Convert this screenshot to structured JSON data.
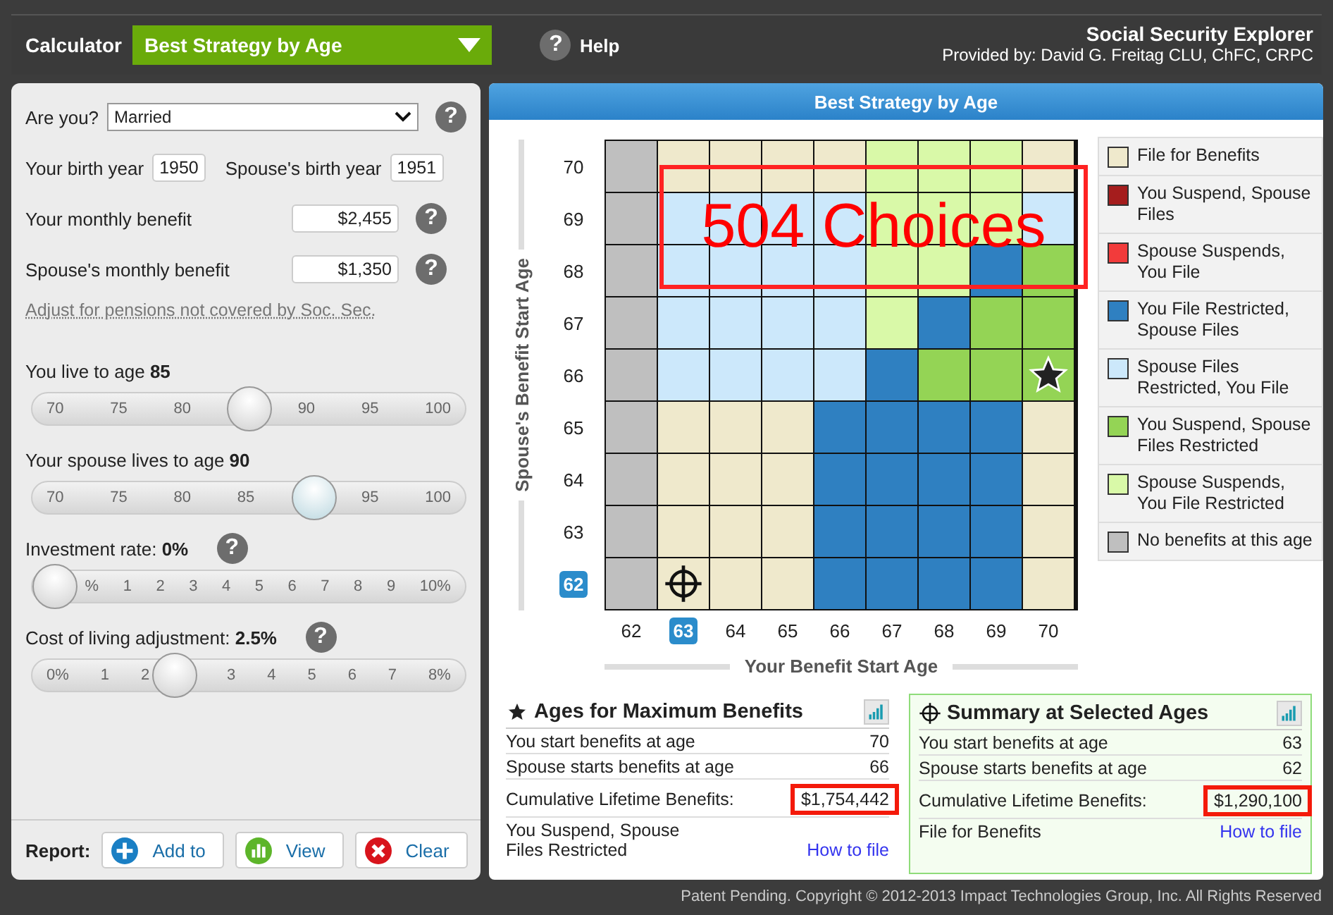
{
  "top_bar": {
    "label": "Calculator",
    "dropdown": "Best Strategy by Age",
    "help": {
      "glyph": "?",
      "label": "Help"
    },
    "title": "Social Security Explorer",
    "provider": "Provided by: David G. Freitag CLU, ChFC, CRPC"
  },
  "inputs": {
    "marital": {
      "label": "Are you?",
      "value": "Married",
      "help": "?"
    },
    "birth_years": [
      {
        "label": "Your birth year",
        "value": "1950"
      },
      {
        "label": "Spouse's birth year",
        "value": "1951"
      }
    ],
    "benefits": [
      {
        "label": "Your monthly benefit",
        "value": "$2,455",
        "help": "?"
      },
      {
        "label": "Spouse's monthly benefit",
        "value": "$1,350",
        "help": "?"
      }
    ],
    "adjust_link": "Adjust for pensions not covered by Soc. Sec."
  },
  "sliders": [
    {
      "label": "You live to age **85**",
      "level": 0.5,
      "ticks": [
        "70",
        "75",
        "80",
        "90",
        "95",
        "100"
      ]
    },
    {
      "label": "Your spouse lives to age **90**",
      "level": 0.67,
      "ticks": [
        "70",
        "75",
        "80",
        "85",
        "95",
        "100"
      ]
    },
    {
      "label": "Investment rate: **0%**",
      "help": "?",
      "level": 0,
      "ticks": [
        "%",
        "1",
        "2",
        "3",
        "4",
        "5",
        "6",
        "7",
        "8",
        "9",
        "10%"
      ]
    },
    {
      "label": "Cost of living adjustment: **2.5%**",
      "help": "?",
      "level": 0.31,
      "ticks": [
        "0%",
        "1",
        "2",
        "3",
        "4",
        "5",
        "6",
        "7",
        "8%"
      ]
    }
  ],
  "report": {
    "label": "Report:",
    "buttons": [
      {
        "kind": "add",
        "label": "Add to"
      },
      {
        "kind": "view",
        "label": "View"
      },
      {
        "kind": "clear",
        "label": "Clear"
      }
    ]
  },
  "chart": {
    "title": "Best Strategy by Age",
    "y_title": "Spouse's Benefit Start Age",
    "x_title": "Your Benefit Start Age",
    "annotation": "504 Choices",
    "rows": [
      {
        "label": "70",
        "selected": false,
        "cells": [
          {
            "kind": "none",
            "selected": false,
            "best": false
          },
          {
            "kind": "file",
            "selected": false,
            "best": false
          },
          {
            "kind": "file",
            "selected": false,
            "best": false
          },
          {
            "kind": "file",
            "selected": false,
            "best": false
          },
          {
            "kind": "file",
            "selected": false,
            "best": false
          },
          {
            "kind": "ss_restricted",
            "selected": false,
            "best": false
          },
          {
            "kind": "ss_restricted",
            "selected": false,
            "best": false
          },
          {
            "kind": "ss_restricted",
            "selected": false,
            "best": false
          },
          {
            "kind": "file",
            "selected": false,
            "best": false
          }
        ]
      },
      {
        "label": "69",
        "selected": false,
        "cells": [
          {
            "kind": "none",
            "selected": false,
            "best": false
          },
          {
            "kind": "spouse_restricted",
            "selected": false,
            "best": false
          },
          {
            "kind": "spouse_restricted",
            "selected": false,
            "best": false
          },
          {
            "kind": "spouse_restricted",
            "selected": false,
            "best": false
          },
          {
            "kind": "spouse_restricted",
            "selected": false,
            "best": false
          },
          {
            "kind": "ss_restricted",
            "selected": false,
            "best": false
          },
          {
            "kind": "ss_restricted",
            "selected": false,
            "best": false
          },
          {
            "kind": "ss_restricted",
            "selected": false,
            "best": false
          },
          {
            "kind": "spouse_restricted",
            "selected": false,
            "best": false
          }
        ]
      },
      {
        "label": "68",
        "selected": false,
        "cells": [
          {
            "kind": "none",
            "selected": false,
            "best": false
          },
          {
            "kind": "spouse_restricted",
            "selected": false,
            "best": false
          },
          {
            "kind": "spouse_restricted",
            "selected": false,
            "best": false
          },
          {
            "kind": "spouse_restricted",
            "selected": false,
            "best": false
          },
          {
            "kind": "spouse_restricted",
            "selected": false,
            "best": false
          },
          {
            "kind": "ss_restricted",
            "selected": false,
            "best": false
          },
          {
            "kind": "ss_restricted",
            "selected": false,
            "best": false
          },
          {
            "kind": "you_restricted",
            "selected": false,
            "best": false
          },
          {
            "kind": "ys_restricted",
            "selected": false,
            "best": false
          }
        ]
      },
      {
        "label": "67",
        "selected": false,
        "cells": [
          {
            "kind": "none",
            "selected": false,
            "best": false
          },
          {
            "kind": "spouse_restricted",
            "selected": false,
            "best": false
          },
          {
            "kind": "spouse_restricted",
            "selected": false,
            "best": false
          },
          {
            "kind": "spouse_restricted",
            "selected": false,
            "best": false
          },
          {
            "kind": "spouse_restricted",
            "selected": false,
            "best": false
          },
          {
            "kind": "ss_restricted",
            "selected": false,
            "best": false
          },
          {
            "kind": "you_restricted",
            "selected": false,
            "best": false
          },
          {
            "kind": "ys_restricted",
            "selected": false,
            "best": false
          },
          {
            "kind": "ys_restricted",
            "selected": false,
            "best": false
          }
        ]
      },
      {
        "label": "66",
        "selected": false,
        "cells": [
          {
            "kind": "none",
            "selected": false,
            "best": false
          },
          {
            "kind": "spouse_restricted",
            "selected": false,
            "best": false
          },
          {
            "kind": "spouse_restricted",
            "selected": false,
            "best": false
          },
          {
            "kind": "spouse_restricted",
            "selected": false,
            "best": false
          },
          {
            "kind": "spouse_restricted",
            "selected": false,
            "best": false
          },
          {
            "kind": "you_restricted",
            "selected": false,
            "best": false
          },
          {
            "kind": "ys_restricted",
            "selected": false,
            "best": false
          },
          {
            "kind": "ys_restricted",
            "selected": false,
            "best": false
          },
          {
            "kind": "ys_restricted",
            "selected": false,
            "best": true
          }
        ]
      },
      {
        "label": "65",
        "selected": false,
        "cells": [
          {
            "kind": "none",
            "selected": false,
            "best": false
          },
          {
            "kind": "file",
            "selected": false,
            "best": false
          },
          {
            "kind": "file",
            "selected": false,
            "best": false
          },
          {
            "kind": "file",
            "selected": false,
            "best": false
          },
          {
            "kind": "you_restricted",
            "selected": false,
            "best": false
          },
          {
            "kind": "you_restricted",
            "selected": false,
            "best": false
          },
          {
            "kind": "you_restricted",
            "selected": false,
            "best": false
          },
          {
            "kind": "you_restricted",
            "selected": false,
            "best": false
          },
          {
            "kind": "file",
            "selected": false,
            "best": false
          }
        ]
      },
      {
        "label": "64",
        "selected": false,
        "cells": [
          {
            "kind": "none",
            "selected": false,
            "best": false
          },
          {
            "kind": "file",
            "selected": false,
            "best": false
          },
          {
            "kind": "file",
            "selected": false,
            "best": false
          },
          {
            "kind": "file",
            "selected": false,
            "best": false
          },
          {
            "kind": "you_restricted",
            "selected": false,
            "best": false
          },
          {
            "kind": "you_restricted",
            "selected": false,
            "best": false
          },
          {
            "kind": "you_restricted",
            "selected": false,
            "best": false
          },
          {
            "kind": "you_restricted",
            "selected": false,
            "best": false
          },
          {
            "kind": "file",
            "selected": false,
            "best": false
          }
        ]
      },
      {
        "label": "63",
        "selected": false,
        "cells": [
          {
            "kind": "none",
            "selected": false,
            "best": false
          },
          {
            "kind": "file",
            "selected": false,
            "best": false
          },
          {
            "kind": "file",
            "selected": false,
            "best": false
          },
          {
            "kind": "file",
            "selected": false,
            "best": false
          },
          {
            "kind": "you_restricted",
            "selected": false,
            "best": false
          },
          {
            "kind": "you_restricted",
            "selected": false,
            "best": false
          },
          {
            "kind": "you_restricted",
            "selected": false,
            "best": false
          },
          {
            "kind": "you_restricted",
            "selected": false,
            "best": false
          },
          {
            "kind": "file",
            "selected": false,
            "best": false
          }
        ]
      },
      {
        "label": "62",
        "selected": true,
        "cells": [
          {
            "kind": "none",
            "selected": false,
            "best": false
          },
          {
            "kind": "file",
            "selected": true,
            "best": false
          },
          {
            "kind": "file",
            "selected": false,
            "best": false
          },
          {
            "kind": "file",
            "selected": false,
            "best": false
          },
          {
            "kind": "you_restricted",
            "selected": false,
            "best": false
          },
          {
            "kind": "you_restricted",
            "selected": false,
            "best": false
          },
          {
            "kind": "you_restricted",
            "selected": false,
            "best": false
          },
          {
            "kind": "you_restricted",
            "selected": false,
            "best": false
          },
          {
            "kind": "file",
            "selected": false,
            "best": false
          }
        ]
      }
    ],
    "columns": [
      {
        "label": "62",
        "selected": false
      },
      {
        "label": "63",
        "selected": true
      },
      {
        "label": "64",
        "selected": false
      },
      {
        "label": "65",
        "selected": false
      },
      {
        "label": "66",
        "selected": false
      },
      {
        "label": "67",
        "selected": false
      },
      {
        "label": "68",
        "selected": false
      },
      {
        "label": "69",
        "selected": false
      },
      {
        "label": "70",
        "selected": false
      }
    ]
  },
  "legend": [
    {
      "kind": "file",
      "label": "File for Benefits",
      "color": "#efe9cc"
    },
    {
      "kind": "you_suspend",
      "label": "You Suspend, Spouse Files",
      "color": "#a51d1d"
    },
    {
      "kind": "spouse_suspends",
      "label": "Spouse Suspends, You File",
      "color": "#f23b3b"
    },
    {
      "kind": "you_restricted",
      "label": "You File Restricted, Spouse Files",
      "color": "#2f80c1"
    },
    {
      "kind": "spouse_restricted",
      "label": "Spouse Files Restricted, You File",
      "color": "#cce8fb"
    },
    {
      "kind": "ys_restricted",
      "label": "You Suspend, Spouse Files Restricted",
      "color": "#94d455"
    },
    {
      "kind": "ss_restricted",
      "label": "Spouse Suspends, You File Restricted",
      "color": "#d9f9a8"
    },
    {
      "kind": "none",
      "label": "No benefits at this age",
      "color": "#bfbfbf"
    }
  ],
  "summaries": [
    {
      "kind": "max",
      "title": "Ages for Maximum Benefits",
      "rows": [
        {
          "label": "You start benefits at age",
          "value": "70",
          "highlighted": false
        },
        {
          "label": "Spouse starts benefits at age",
          "value": "66",
          "highlighted": false
        },
        {
          "label": "Cumulative Lifetime Benefits:",
          "value": "$1,754,442",
          "highlighted": true
        }
      ],
      "strategy": "You Suspend, Spouse Files Restricted",
      "link": "How to file"
    },
    {
      "kind": "selected",
      "title": "Summary at Selected Ages",
      "rows": [
        {
          "label": "You start benefits at age",
          "value": "63",
          "highlighted": false
        },
        {
          "label": "Spouse starts benefits at age",
          "value": "62",
          "highlighted": false
        },
        {
          "label": "Cumulative Lifetime Benefits:",
          "value": "$1,290,100",
          "highlighted": true
        }
      ],
      "strategy": "File for Benefits",
      "link": "How to file"
    }
  ],
  "footer": "Patent Pending. Copyright © 2012-2013 Impact Technologies Group, Inc. All Rights Reserved"
}
